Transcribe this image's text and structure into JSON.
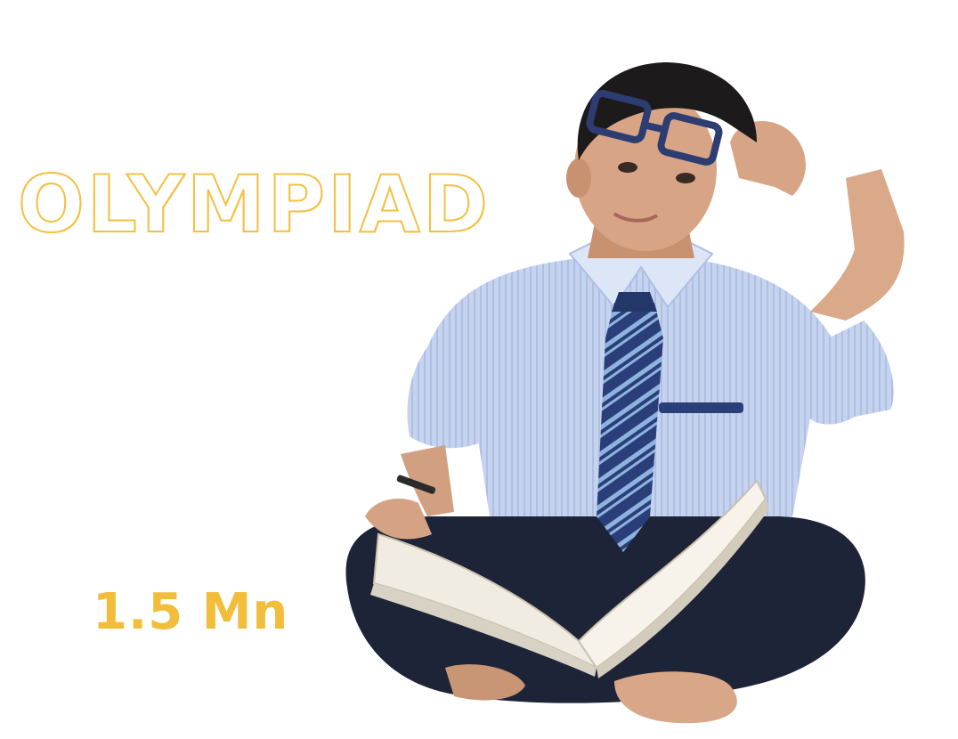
{
  "headline": "OLYMPIAD",
  "stat": "1.5 Mn",
  "colors": {
    "accent": "#f3c043",
    "background": "#ffffff"
  }
}
